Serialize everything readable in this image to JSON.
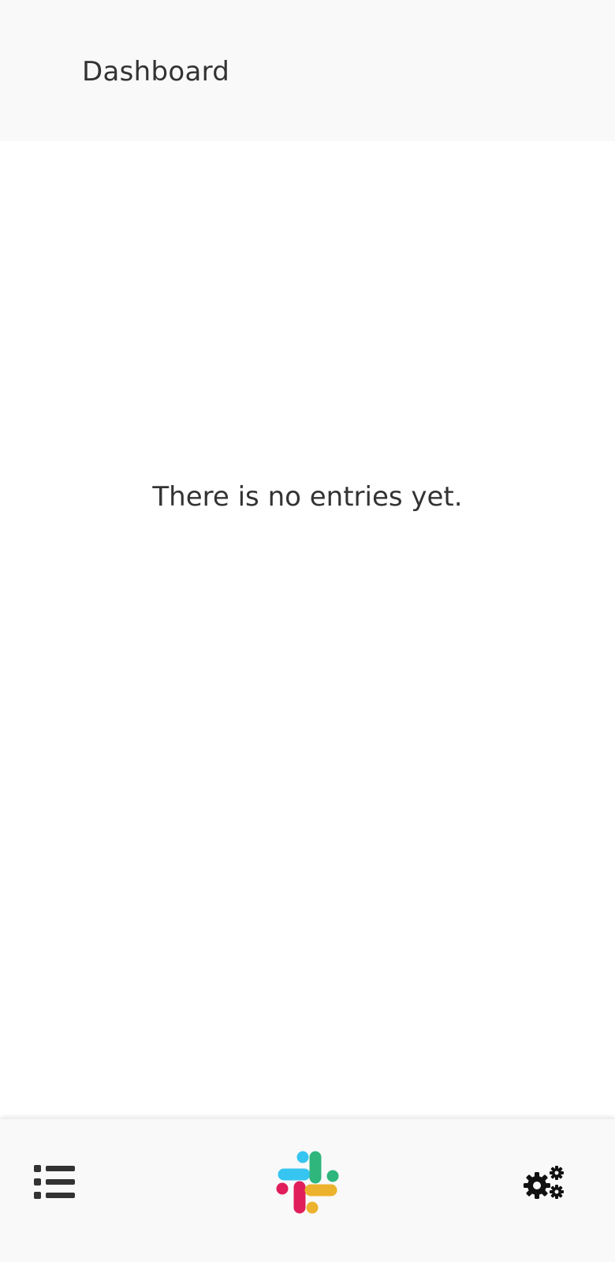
{
  "header": {
    "title": "Dashboard"
  },
  "main": {
    "empty_message": "There is no entries yet."
  },
  "bottom_nav": {
    "items": [
      {
        "icon": "list-icon"
      },
      {
        "icon": "slack-logo-icon"
      },
      {
        "icon": "cogs-icon"
      }
    ]
  },
  "colors": {
    "bar_background": "#f9f9f9",
    "text": "#333333",
    "slack_blue": "#36c5f0",
    "slack_green": "#2eb67d",
    "slack_red": "#e01e5a",
    "slack_yellow": "#ecb22e"
  }
}
